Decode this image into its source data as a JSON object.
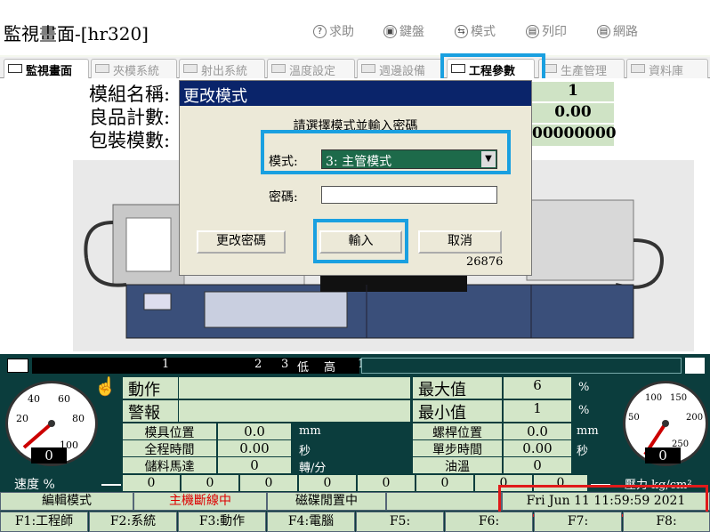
{
  "title": "監視畫面-[hr320]",
  "toolbar": [
    {
      "icon": "?",
      "label": "求助"
    },
    {
      "icon": "▣",
      "label": "鍵盤"
    },
    {
      "icon": "⇆",
      "label": "模式"
    },
    {
      "icon": "▤",
      "label": "列印"
    },
    {
      "icon": "▤",
      "label": "網路"
    }
  ],
  "tabs": [
    "監視畫面",
    "夾模系統",
    "射出系統",
    "溫度設定",
    "週邊設備",
    "工程參數",
    "生產管理",
    "資料庫"
  ],
  "info": {
    "mold_name_label": "模組名稱:",
    "mold_name_value": "1",
    "good_count_label": "良品計數:",
    "good_count_value": "0.00",
    "pack_count_label": "包裝模數:",
    "pack_count_value": "00000000"
  },
  "dialog": {
    "title": "更改模式",
    "prompt": "請選擇模式並輸入密碼",
    "mode_label": "模式:",
    "mode_value": "3: 主管模式",
    "password_label": "密碼:",
    "password_value": "",
    "change_pw_label": "更改密碼",
    "enter_label": "輸入",
    "cancel_label": "取消",
    "code": "26876"
  },
  "ribbon": {
    "n1": "1",
    "n2": "2",
    "n3": "3",
    "low": "低",
    "high": "高",
    "n4": "1"
  },
  "panel": {
    "action": "動作",
    "alarm": "警報",
    "mold_pos": "模具位置",
    "mold_pos_val": "0.0",
    "mm": "mm",
    "cycle_time": "全程時間",
    "cycle_val": "0.00",
    "sec": "秒",
    "motor": "儲料馬達",
    "motor_val": "0",
    "rpm": "轉/分",
    "max": "最大值",
    "max_val": "6",
    "pct": "%",
    "min": "最小值",
    "min_val": "1",
    "screw_pos": "螺桿位置",
    "screw_val": "0.0",
    "step_time": "單步時間",
    "step_val": "0.00",
    "oil_temp": "油溫",
    "oil_val": "0",
    "speed_label": "速度 %",
    "pressure_label": "壓力 kg/cm²",
    "speed_gauge_val": "0",
    "pressure_gauge_val": "0",
    "speed_ticks": [
      "40",
      "60",
      "20",
      "80",
      "100"
    ],
    "pressure_ticks": [
      "100",
      "150",
      "50",
      "200",
      "250"
    ],
    "zeros": [
      "0",
      "0",
      "0",
      "0",
      "0",
      "0",
      "0",
      "0"
    ]
  },
  "status": {
    "mode": "編輯模式",
    "host": "主機斷線中",
    "disk": "磁碟閒置中",
    "datetime": "Fri Jun 11 11:59:59 2021"
  },
  "fkeys": [
    "F1:工程師",
    "F2:系統",
    "F3:動作",
    "F4:電腦",
    "F5:",
    "F6:",
    "F7:",
    "F8:"
  ],
  "colors": {
    "panel": "#0b3d3d",
    "cell": "#d3e6c8",
    "highlight": "#1aa0e0",
    "alert": "#e01a1a",
    "dialog_head": "#0a246a"
  }
}
